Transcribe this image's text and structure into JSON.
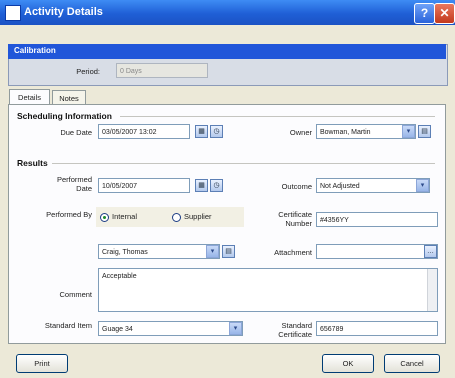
{
  "window": {
    "title": "Activity Details",
    "help": "?",
    "close": "✕"
  },
  "calibration": {
    "header": "Calibration",
    "period_label": "Period:",
    "period_value": "0 Days"
  },
  "tabs": [
    {
      "label": "Details",
      "active": true
    },
    {
      "label": "Notes",
      "active": false
    }
  ],
  "scheduling": {
    "section_title": "Scheduling Information",
    "due_date_label": "Due Date",
    "due_date_value": "03/05/2007 13:02",
    "owner_label": "Owner",
    "owner_value": "Bowman, Martin"
  },
  "results": {
    "section_title": "Results",
    "performed_date_label": "Performed Date",
    "performed_date_value": "10/05/2007",
    "outcome_label": "Outcome",
    "outcome_value": "Not Adjusted",
    "performed_by_label": "Performed By",
    "radio_internal": "Internal",
    "radio_supplier": "Supplier",
    "performed_by_selected": "Internal",
    "certificate_number_label": "Certificate Number",
    "certificate_number_value": "#4356YY",
    "performer_value": "Craig, Thomas",
    "attachment_label": "Attachment",
    "attachment_value": "",
    "comment_label": "Comment",
    "comment_value": "Acceptable",
    "standard_item_label": "Standard Item",
    "standard_item_value": "Guage 34",
    "standard_certificate_label": "Standard Certificate",
    "standard_certificate_value": "656789"
  },
  "buttons": {
    "print": "Print",
    "ok": "OK",
    "cancel": "Cancel"
  },
  "icons": {
    "calendar": "calendar-icon",
    "dropdown": "chevron-down-icon",
    "lookup": "lookup-icon",
    "ellipsis": "ellipsis-icon"
  },
  "colors": {
    "titlebar": "#1F5FD6",
    "calibration_header": "#2156D9",
    "dialog_bg": "#ECE9D8"
  }
}
